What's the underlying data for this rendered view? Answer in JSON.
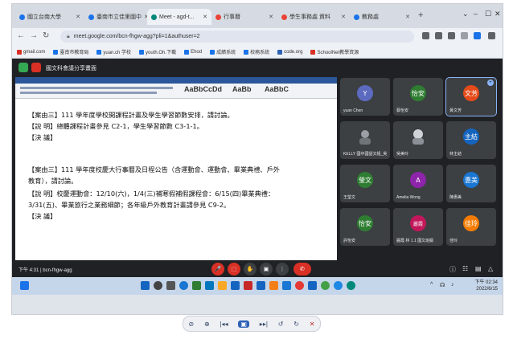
{
  "browser": {
    "tabs": [
      {
        "label": "國立台南大學",
        "color": "#1a73e8"
      },
      {
        "label": "臺南市立佳里國中",
        "color": "#1a73e8"
      },
      {
        "label": "Meet - agd-t...",
        "color": "#00897b"
      },
      {
        "label": "行事曆",
        "color": "#ea4335"
      },
      {
        "label": "學生事務處 資料",
        "color": "#ea4335"
      },
      {
        "label": "教務處",
        "color": "#1a73e8"
      }
    ],
    "new_tab": "+",
    "url": "meet.google.com/bcn-fhgw-agg?pli=1&authuser=2",
    "bookmarks": [
      {
        "label": "gmail.com",
        "color": "#d93025"
      },
      {
        "label": "臺南市教育局",
        "color": "#1a73e8"
      },
      {
        "label": "yuan.ch 学校",
        "color": "#1a73e8"
      },
      {
        "label": "youth.Oh.下載",
        "color": "#1a73e8"
      },
      {
        "label": "Ehod",
        "color": "#1a73e8"
      },
      {
        "label": "成績系統",
        "color": "#1a73e8"
      },
      {
        "label": "校務系統",
        "color": "#1a73e8"
      },
      {
        "label": "code.org",
        "color": "#2d62b4"
      },
      {
        "label": "SchoolNet教學資源",
        "color": "#d93025"
      }
    ]
  },
  "meet": {
    "title": "國文科會議分享畫面",
    "meeting_code": "下午 4:31 | bcn-fhgw-agg",
    "document_lines": [
      "【案由三】111 學年度學校開課程計畫及學生學習節數安排，請討論。",
      "【說   明】總體課程計畫參見 C2-1，學生學習節數 C3-1-1。",
      "【決   議】",
      "【案由三】111 學年度校慶大行事曆及日程公告（含運動會、運動會、畢業典禮、戶外",
      "           教育），請討論。",
      "【說   明】校慶運動會：12/10(六)，1/4(三)補寒假補假課程會：6/15(四)畢業典禮：",
      "3/31(五)、畢業旅行之業務細節；各年級戶外教育計畫請參見 C9-2。",
      "【決   議】"
    ],
    "participants": [
      {
        "avatar": "Y",
        "name": "yuan Chen",
        "color": "#5c6bc0"
      },
      {
        "avatar": "怡安",
        "name": "蔡怡安",
        "color": "#2e7d32"
      },
      {
        "avatar": "文芳",
        "name": "黃文芳",
        "color": "#e64a19"
      },
      {
        "avatar": "",
        "name": "KELLY 國中國語文組_吳",
        "color": "#3c4043"
      },
      {
        "avatar": "",
        "name": "吳美玲",
        "color": "#3c4043"
      },
      {
        "avatar": "主結",
        "name": "林主結",
        "color": "#1565c0"
      },
      {
        "avatar": "瑩文",
        "name": "王瑩文",
        "color": "#2e7d32"
      },
      {
        "avatar": "A",
        "name": "Amelia Wong",
        "color": "#8e24aa"
      },
      {
        "avatar": "惠美",
        "name": "陳惠美",
        "color": "#1976d2"
      },
      {
        "avatar": "怡安",
        "name": "許怡安",
        "color": "#2e7d32"
      },
      {
        "avatar": "麗霞",
        "name": "麗霞 林 1.1 國文班級",
        "color": "#c2185b"
      },
      {
        "avatar": "佳玲",
        "name": "佳玲",
        "color": "#f57c00"
      }
    ],
    "controls": {
      "leave": "✆",
      "mic": "🎤",
      "cam": "⬚",
      "raise": "✋",
      "present": "▣",
      "more": "⋮"
    }
  },
  "taskbar": {
    "time": "下午 02:34",
    "date": "2022/6/15"
  },
  "pdf_toolbar": {
    "items": [
      "⊘",
      "⊕",
      "|◂◂",
      "▣",
      "▸▸|",
      "↺",
      "↻",
      "✕"
    ]
  },
  "colors": {
    "meet_bg": "#202124",
    "tile_bg": "#3c4043",
    "leave_red": "#d93025",
    "taskbar": "#c6d6ea"
  }
}
